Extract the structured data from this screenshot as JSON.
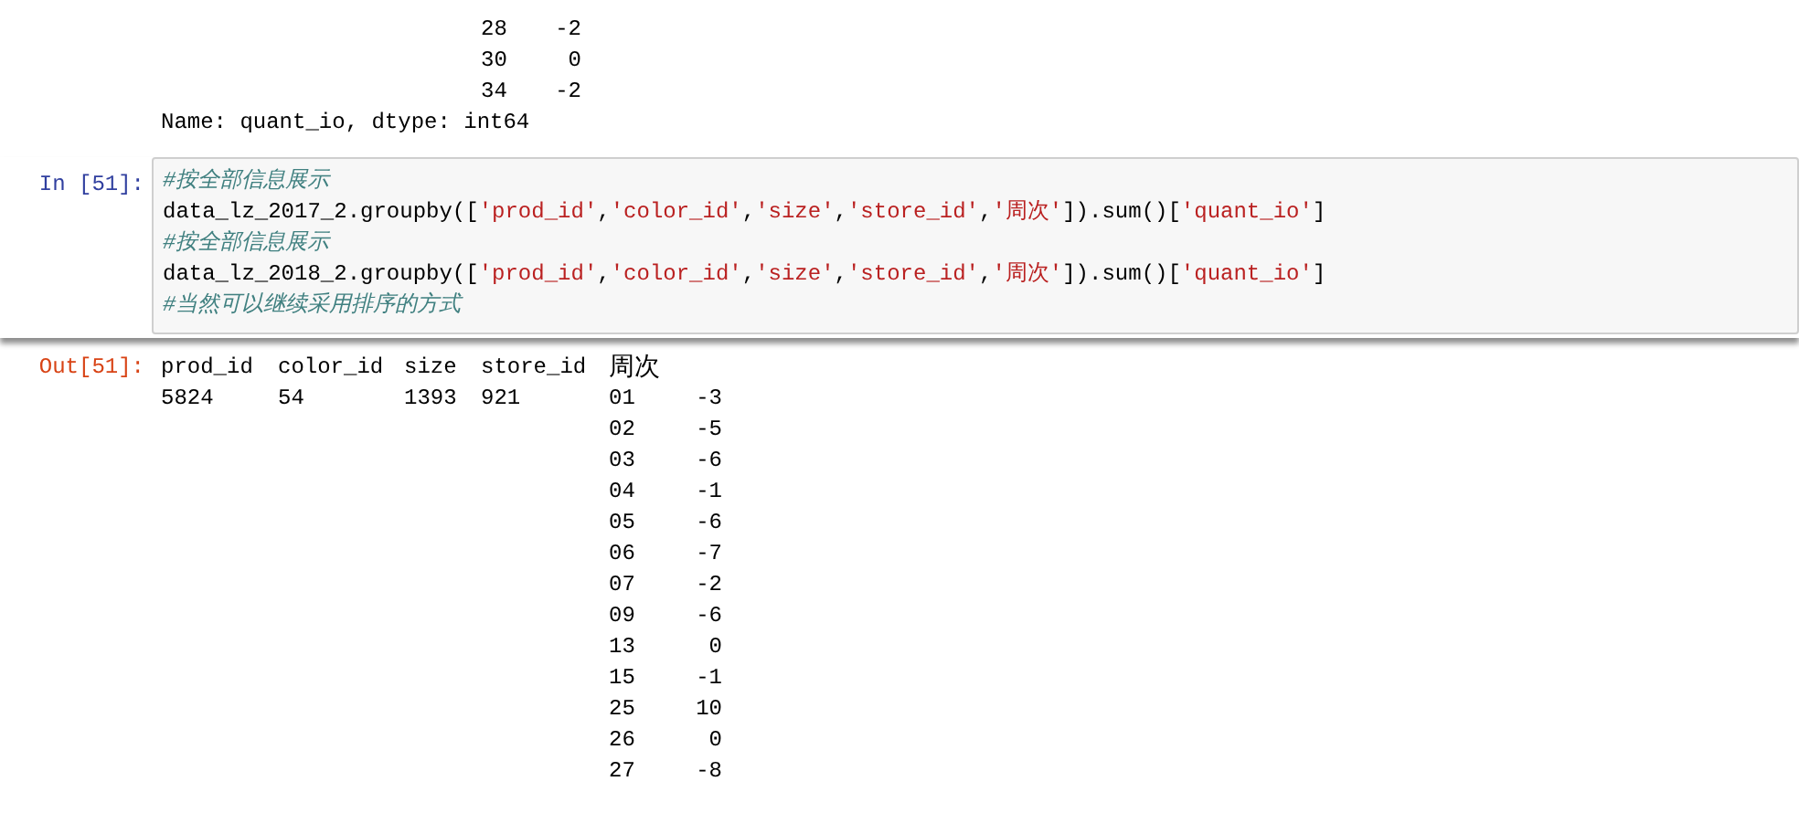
{
  "previous_output": {
    "rows": [
      {
        "index": "28",
        "value": "-2"
      },
      {
        "index": "30",
        "value": "0"
      },
      {
        "index": "34",
        "value": "-2"
      }
    ],
    "footer": "Name: quant_io, dtype: int64"
  },
  "input_cell": {
    "prompt": "In [51]:",
    "code_lines": [
      [
        {
          "kind": "comment",
          "text": "#按全部信息展示"
        }
      ],
      [
        {
          "kind": "code",
          "text": "data_lz_2017_2.groupby(["
        },
        {
          "kind": "string",
          "text": "'prod_id'"
        },
        {
          "kind": "code",
          "text": ","
        },
        {
          "kind": "string",
          "text": "'color_id'"
        },
        {
          "kind": "code",
          "text": ","
        },
        {
          "kind": "string",
          "text": "'size'"
        },
        {
          "kind": "code",
          "text": ","
        },
        {
          "kind": "string",
          "text": "'store_id'"
        },
        {
          "kind": "code",
          "text": ","
        },
        {
          "kind": "string",
          "text": "'周次'"
        },
        {
          "kind": "code",
          "text": "]).sum()["
        },
        {
          "kind": "string",
          "text": "'quant_io'"
        },
        {
          "kind": "code",
          "text": "]"
        }
      ],
      [
        {
          "kind": "comment",
          "text": "#按全部信息展示"
        }
      ],
      [
        {
          "kind": "code",
          "text": "data_lz_2018_2.groupby(["
        },
        {
          "kind": "string",
          "text": "'prod_id'"
        },
        {
          "kind": "code",
          "text": ","
        },
        {
          "kind": "string",
          "text": "'color_id'"
        },
        {
          "kind": "code",
          "text": ","
        },
        {
          "kind": "string",
          "text": "'size'"
        },
        {
          "kind": "code",
          "text": ","
        },
        {
          "kind": "string",
          "text": "'store_id'"
        },
        {
          "kind": "code",
          "text": ","
        },
        {
          "kind": "string",
          "text": "'周次'"
        },
        {
          "kind": "code",
          "text": "]).sum()["
        },
        {
          "kind": "string",
          "text": "'quant_io'"
        },
        {
          "kind": "code",
          "text": "]"
        }
      ],
      [
        {
          "kind": "comment",
          "text": "#当然可以继续采用排序的方式"
        }
      ]
    ]
  },
  "output_cell": {
    "prompt": "Out[51]:",
    "columns": [
      "prod_id",
      "color_id",
      "size",
      "store_id",
      "周次"
    ],
    "first_row": [
      "5824",
      "54",
      "1393",
      "921"
    ],
    "rows": [
      {
        "index": "01",
        "value": "-3"
      },
      {
        "index": "02",
        "value": "-5"
      },
      {
        "index": "03",
        "value": "-6"
      },
      {
        "index": "04",
        "value": "-1"
      },
      {
        "index": "05",
        "value": "-6"
      },
      {
        "index": "06",
        "value": "-7"
      },
      {
        "index": "07",
        "value": "-2"
      },
      {
        "index": "09",
        "value": "-6"
      },
      {
        "index": "13",
        "value": "0"
      },
      {
        "index": "15",
        "value": "-1"
      },
      {
        "index": "25",
        "value": "10"
      },
      {
        "index": "26",
        "value": "0"
      },
      {
        "index": "27",
        "value": "-8"
      }
    ]
  }
}
